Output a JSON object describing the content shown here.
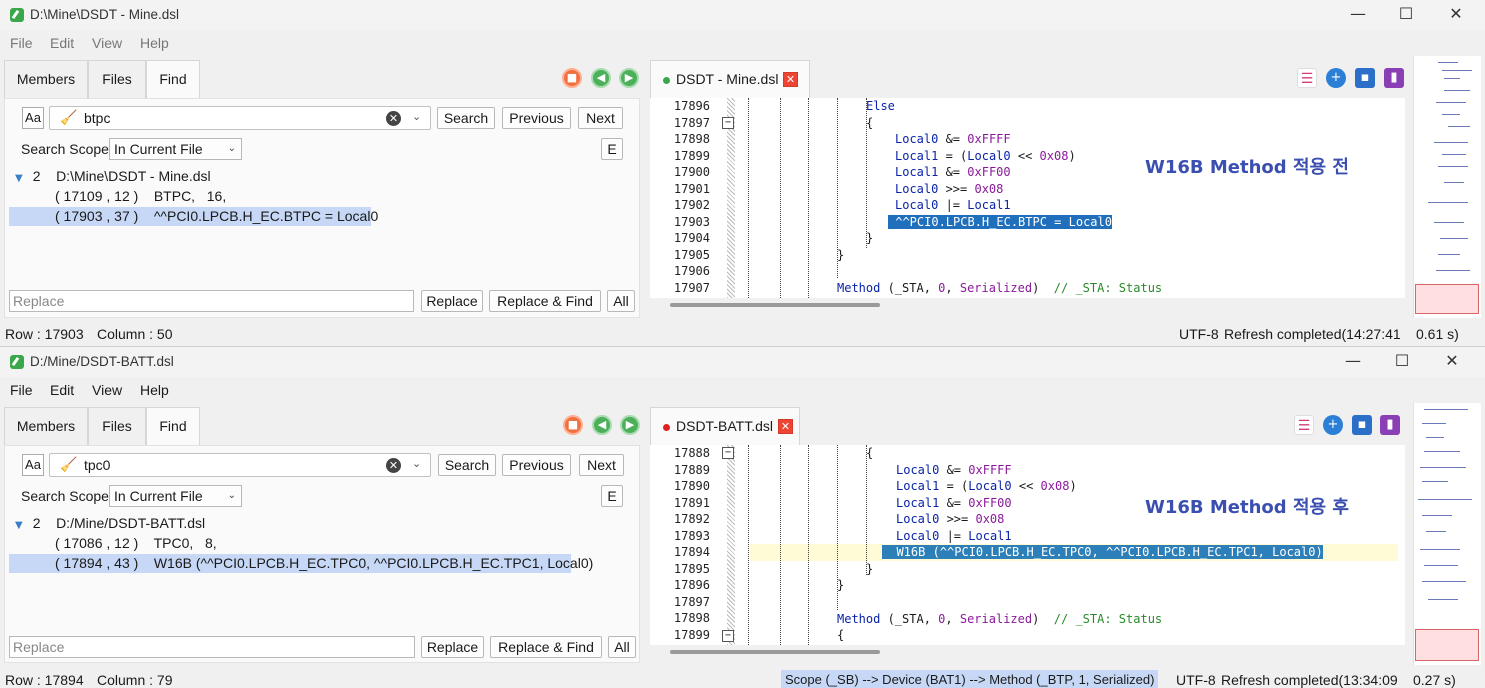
{
  "win1": {
    "title": "D:\\Mine\\DSDT - Mine.dsl",
    "menu": [
      "File",
      "Edit",
      "View",
      "Help"
    ],
    "left_tabs": [
      "Members",
      "Files",
      "Find"
    ],
    "find": {
      "aa": "Aa",
      "query": "btpc",
      "search_label": "Search",
      "previous_label": "Previous",
      "next_label": "Next",
      "scope_label": "Search Scope",
      "scope_value": "In Current File",
      "e_label": "E",
      "result_count": "2",
      "result_file": "D:\\Mine\\DSDT - Mine.dsl",
      "results": [
        {
          "pos": "( 17109 , 12 )",
          "text": "BTPC,   16,"
        },
        {
          "pos": "( 17903 , 37 )",
          "text": "^^PCI0.LPCB.H_EC.BTPC = Local0"
        }
      ],
      "replace_placeholder": "Replace",
      "replace_label": "Replace",
      "replace_find_label": "Replace & Find",
      "all_label": "All"
    },
    "editor_tab": "DSDT - Mine.dsl",
    "tab_dot_color": "#3aa84a",
    "annotation": "W16B Method 적용 전",
    "lines": [
      "17896",
      "17897",
      "17898",
      "17899",
      "17900",
      "17901",
      "17902",
      "17903",
      "17904",
      "17905",
      "17906",
      "17907"
    ],
    "status": {
      "row": "Row : 17903",
      "column": "Column : 50",
      "encoding": "UTF-8",
      "refresh": "Refresh completed(14:27:41",
      "time": "0.61 s)"
    }
  },
  "win2": {
    "title": "D:/Mine/DSDT-BATT.dsl",
    "menu": [
      "File",
      "Edit",
      "View",
      "Help"
    ],
    "left_tabs": [
      "Members",
      "Files",
      "Find"
    ],
    "find": {
      "aa": "Aa",
      "query": "tpc0",
      "search_label": "Search",
      "previous_label": "Previous",
      "next_label": "Next",
      "scope_label": "Search Scope",
      "scope_value": "In Current File",
      "e_label": "E",
      "result_count": "2",
      "result_file": "D:/Mine/DSDT-BATT.dsl",
      "results": [
        {
          "pos": "( 17086 , 12 )",
          "text": "TPC0,   8,"
        },
        {
          "pos": "( 17894 , 43 )",
          "text": "W16B (^^PCI0.LPCB.H_EC.TPC0, ^^PCI0.LPCB.H_EC.TPC1, Local0)"
        }
      ],
      "replace_placeholder": "Replace",
      "replace_label": "Replace",
      "replace_find_label": "Replace & Find",
      "all_label": "All"
    },
    "editor_tab": "DSDT-BATT.dsl",
    "tab_dot_color": "#e02020",
    "annotation": "W16B Method 적용 후",
    "lines": [
      "17888",
      "17889",
      "17890",
      "17891",
      "17892",
      "17893",
      "17894",
      "17895",
      "17896",
      "17897",
      "17898",
      "17899"
    ],
    "status": {
      "row": "Row : 17894",
      "column": "Column : 79",
      "scope": "Scope (_SB) --> Device (BAT1) --> Method (_BTP, 1, Serialized)",
      "encoding": "UTF-8",
      "refresh": "Refresh completed(13:34:09",
      "time": "0.27 s)"
    }
  },
  "window_controls": {
    "minimize": "—",
    "maximize": "☐",
    "close": "✕"
  },
  "icons": [
    "stop-icon",
    "back-arrow-icon",
    "forward-arrow-icon",
    "close-tab-icon",
    "bookmark-list-icon",
    "add-icon",
    "save-icon",
    "bookmark-icon",
    "broom-icon",
    "clear-icon"
  ]
}
